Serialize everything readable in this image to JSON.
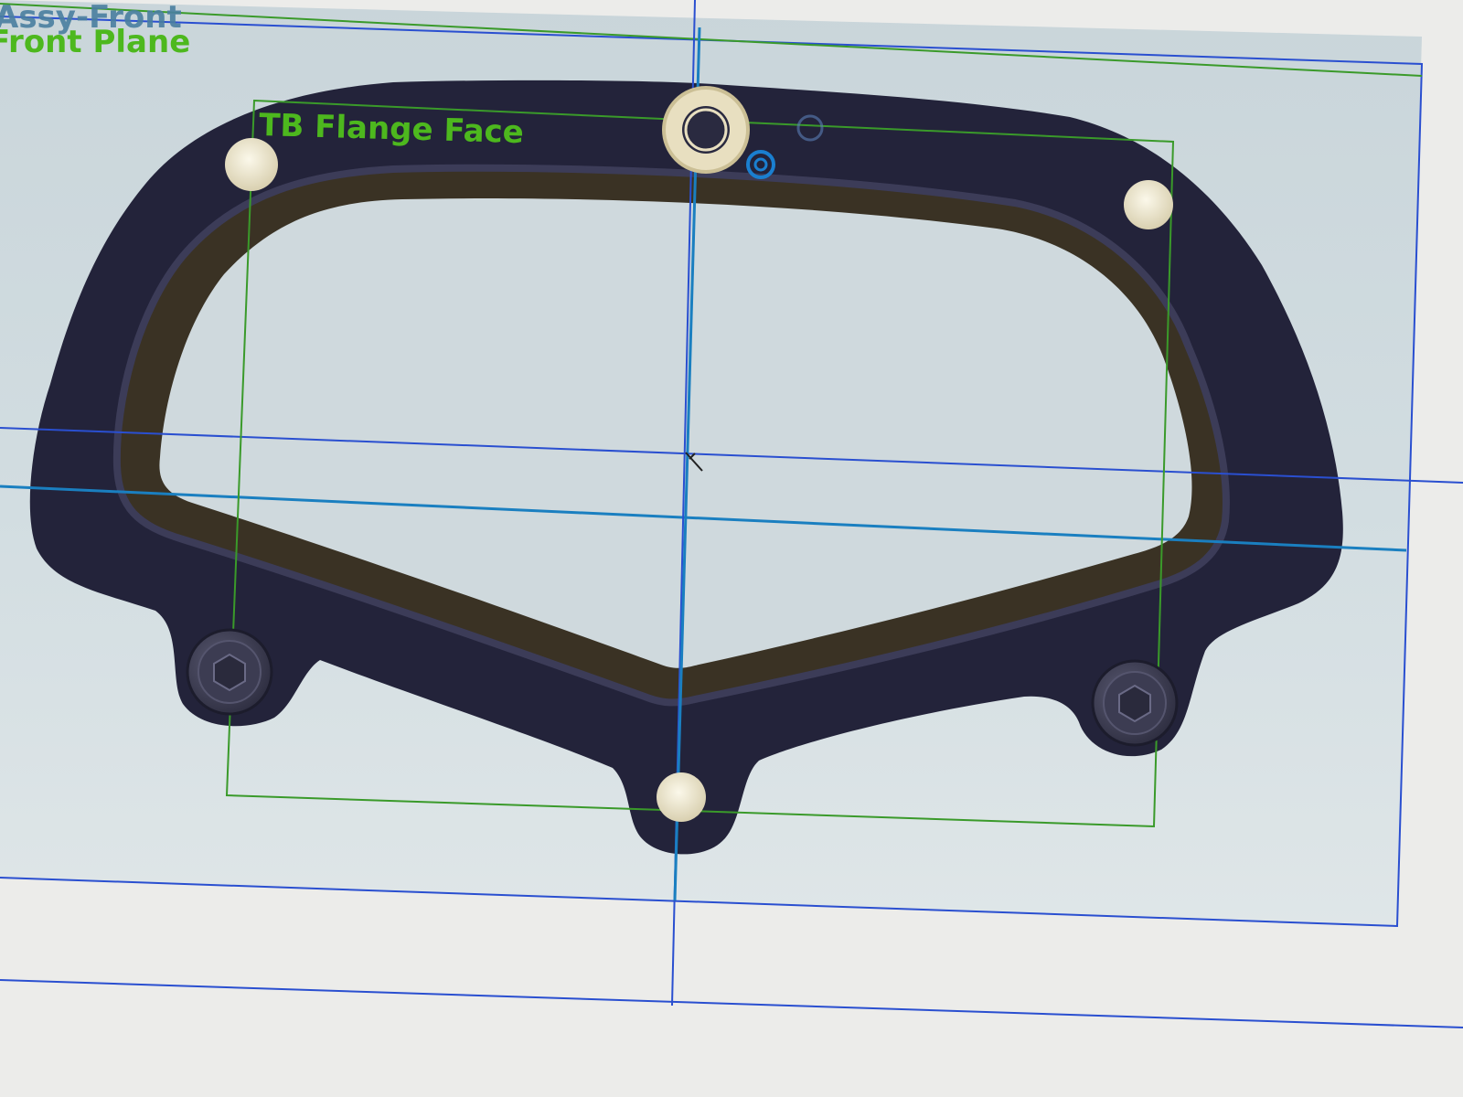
{
  "viewport": {
    "labels": {
      "assy_front": "Assy-Front",
      "front_plane": "Front Plane",
      "tb_flange_face": "TB Flange Face"
    },
    "colors": {
      "plane_label_green": "#4db81e",
      "plane_outline_green": "#3a9a2a",
      "sketch_blue": "#2a4fd0",
      "centerline_cyan": "#1a7fc0",
      "part_body": "#23233a",
      "gasket_groove": "#3a3224",
      "bolt_hole_light": "#f3eed8",
      "plane_fill": "#cdd8dc"
    }
  }
}
